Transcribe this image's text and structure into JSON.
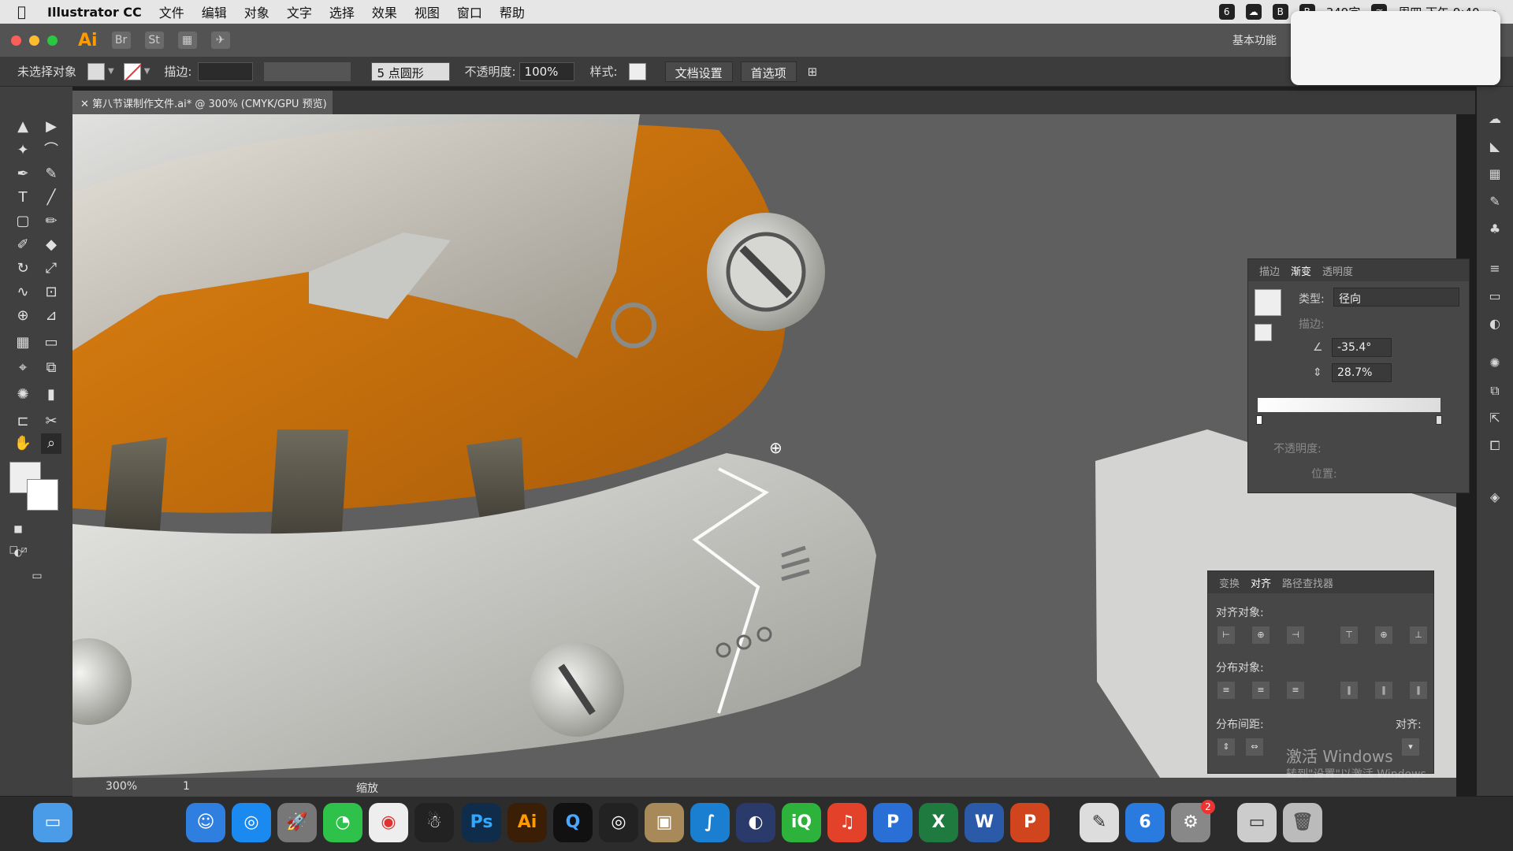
{
  "menubar": {
    "app_name": "Illustrator CC",
    "items": [
      "文件",
      "编辑",
      "对象",
      "文字",
      "选择",
      "效果",
      "视图",
      "窗口",
      "帮助"
    ],
    "battery": "349字",
    "clock": "周四 下午 9:40"
  },
  "topbar": {
    "logo": "Ai",
    "bridge": "Br",
    "stock": "St",
    "workspace": "基本功能"
  },
  "controlbar": {
    "selection": "未选择对象",
    "stroke_label": "描边:",
    "brush_label": "5 点圆形",
    "opacity_label": "不透明度:",
    "opacity_value": "100%",
    "style_label": "样式:",
    "doc_setup": "文档设置",
    "preferences": "首选项"
  },
  "document": {
    "tab_title": "第八节课制作文件.ai* @ 300% (CMYK/GPU 预览)"
  },
  "gradient_panel": {
    "tabs": [
      "描边",
      "渐变",
      "透明度"
    ],
    "active_tab": "渐变",
    "type_label": "类型:",
    "type_value": "径向",
    "stroke_label": "描边:",
    "angle_value": "-35.4°",
    "aspect_value": "28.7%",
    "opacity_label": "不透明度:",
    "location_label": "位置:"
  },
  "align_panel": {
    "tabs": [
      "变换",
      "对齐",
      "路径查找器"
    ],
    "active_tab": "对齐",
    "align_objects": "对齐对象:",
    "distribute_objects": "分布对象:",
    "distribute_spacing": "分布间距:",
    "align_to": "对齐:"
  },
  "statusbar": {
    "zoom": "300%",
    "artboard": "1",
    "tool_name": "缩放"
  },
  "watermark": {
    "title": "激活 Windows",
    "subtitle": "转到\"设置\"以激活 Windows。"
  },
  "dock": {
    "apps": [
      "Finder",
      "Safari",
      "Launchpad",
      "WeChat",
      "Chrome",
      "QQ",
      "Ps",
      "Ai",
      "QuickTime",
      "Aperture",
      "Archiver",
      "Vectorworks",
      "Capture",
      "iQIYI",
      "NetEase",
      "P",
      "Excel",
      "Word",
      "PowerPoint",
      "Preview",
      "6",
      "Settings",
      "Terminal",
      "Trash"
    ],
    "badge_count": "2"
  },
  "colors": {
    "orange": "#c96e0a",
    "canvas_bg": "#5f5f5f",
    "panel_bg": "#474747"
  }
}
